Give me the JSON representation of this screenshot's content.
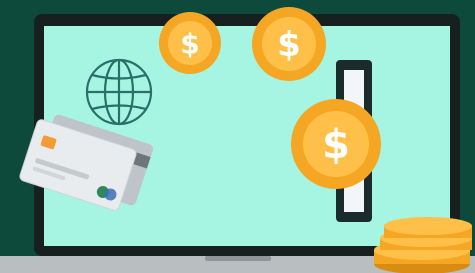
{
  "illustration": {
    "subject": "laptop-online-payment",
    "colors": {
      "background": "#0e4a3c",
      "laptop_bezel": "#15201f",
      "screen": "#a6f5e3",
      "laptop_base": "#b9bec1",
      "coin": "#f5a623",
      "coin_inner": "#ffc04a",
      "card_front": "#e9ecef",
      "card_back": "#bfc4c8",
      "card_chip": "#f39c34",
      "globe_stroke": "#2a6f6a",
      "slot": "#1b2a2a",
      "slot_inner": "#f2f6f8"
    },
    "icons": [
      "globe-icon",
      "credit-card-icon",
      "coin-icon",
      "coin-stack-icon",
      "card-slot-icon",
      "laptop-icon"
    ]
  },
  "coins": [
    {
      "symbol": "$"
    },
    {
      "symbol": "$"
    },
    {
      "symbol": "$"
    }
  ]
}
